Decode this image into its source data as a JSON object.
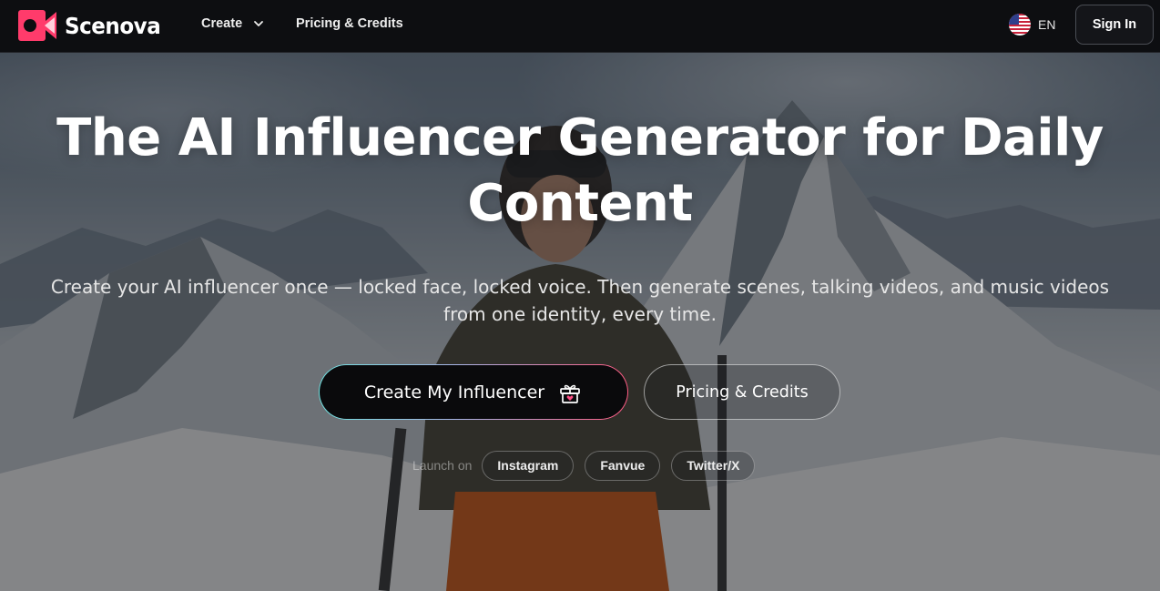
{
  "brand": {
    "name": "Scenova",
    "accent": "#ff3b6b"
  },
  "nav": {
    "create_label": "Create",
    "pricing_label": "Pricing & Credits",
    "language_label": "EN",
    "signin_label": "Sign In"
  },
  "hero": {
    "title": "The AI Influencer Generator for Daily Content",
    "subtitle": "Create your AI influencer once — locked face, locked voice. Then generate scenes, talking videos, and music videos from one identity, every time.",
    "primary_cta": "Create My Influencer",
    "secondary_cta": "Pricing & Credits",
    "launch_label": "Launch on",
    "platforms": [
      "Instagram",
      "Fanvue",
      "Twitter/X"
    ]
  },
  "icons": {
    "logo": "scenova-logo-icon",
    "create_dropdown": "chevron-down-icon",
    "language": "us-flag-icon",
    "primary_cta": "gift-icon"
  },
  "colors": {
    "nav_background": "#0d0e11",
    "cta_gradient_start": "#6fe1e0",
    "cta_gradient_end": "#ff5a82"
  }
}
